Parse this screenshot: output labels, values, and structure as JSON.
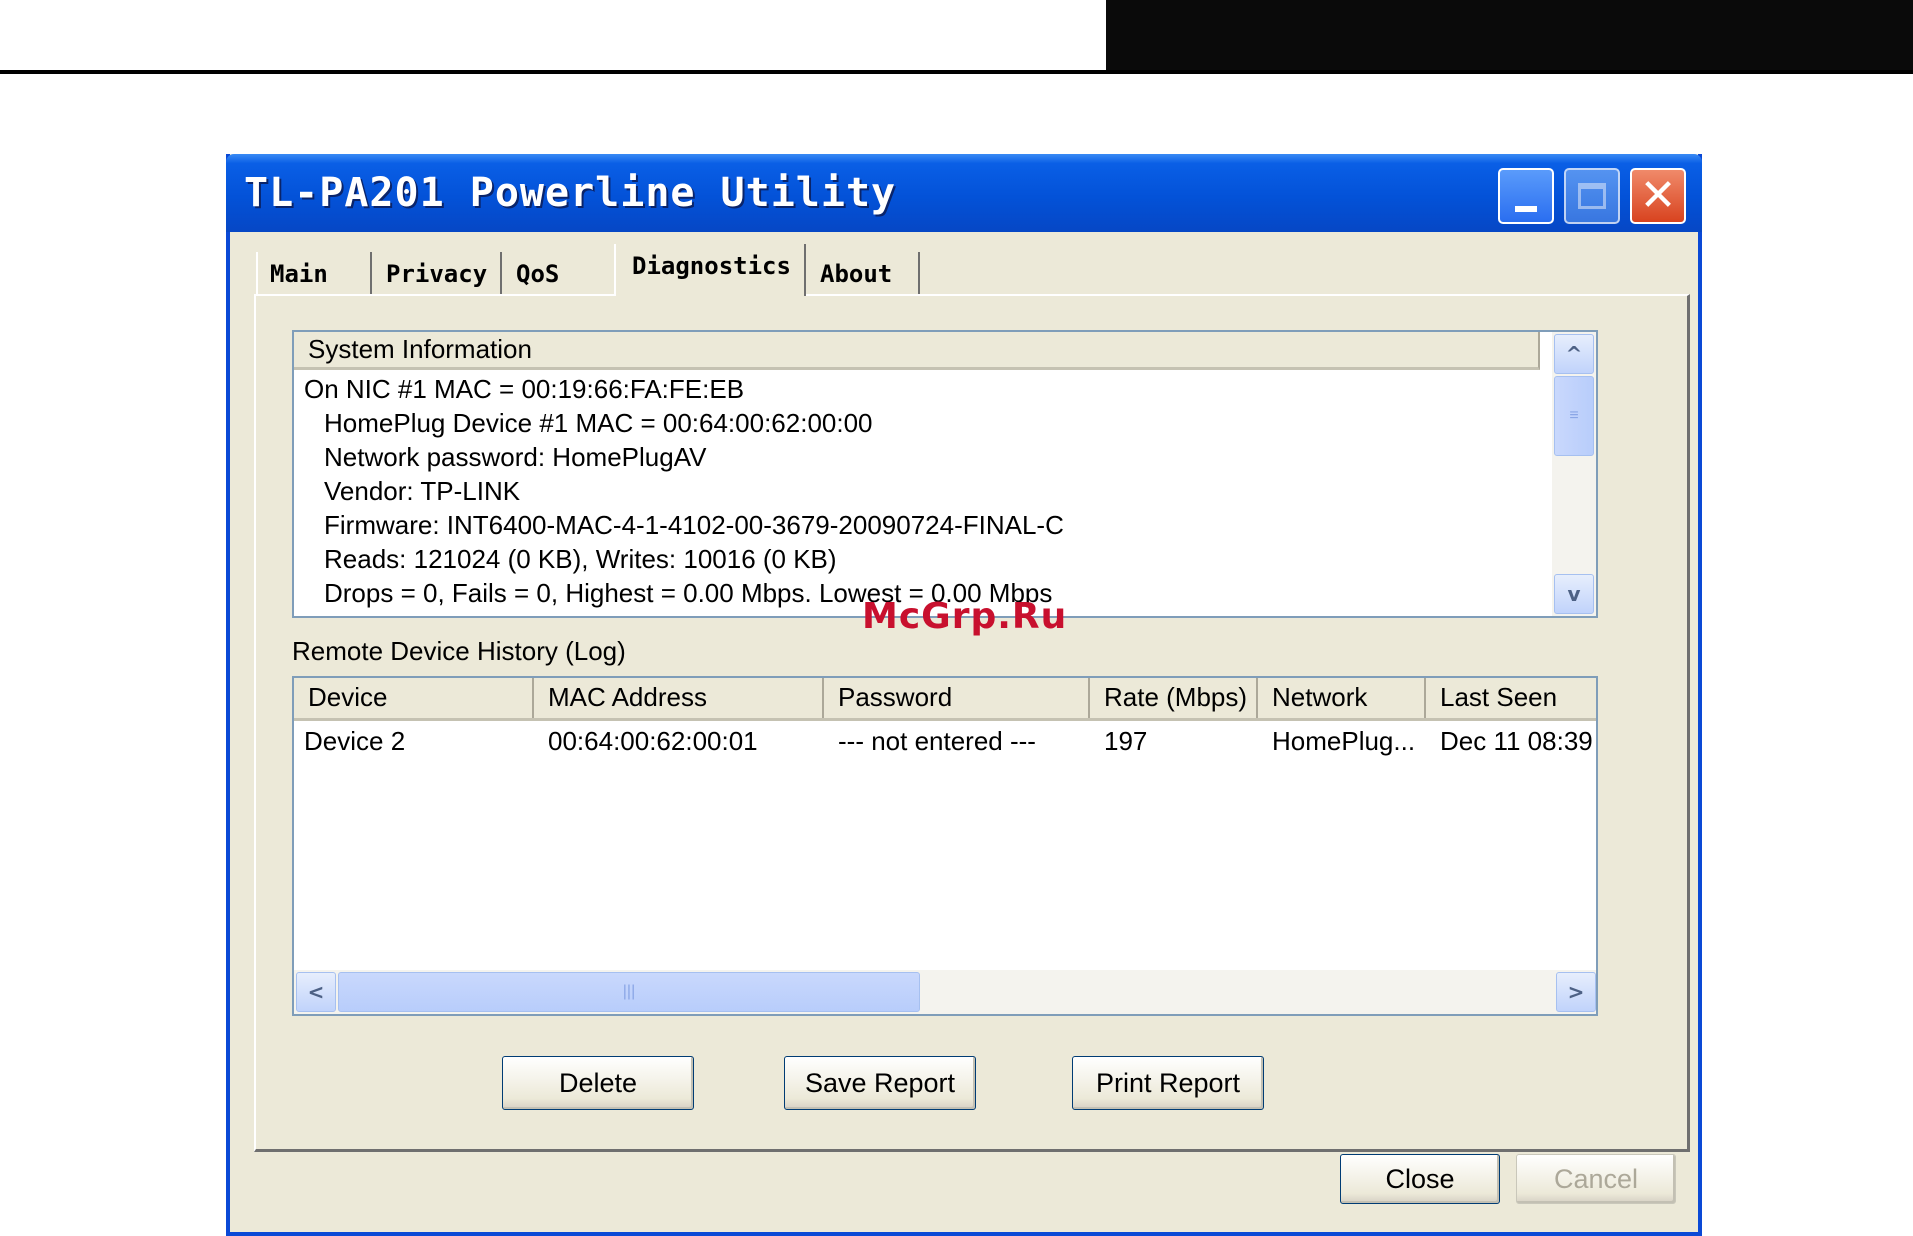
{
  "watermark": "McGrp.Ru",
  "window": {
    "title": "TL-PA201 Powerline Utility",
    "close_glyph": "✕"
  },
  "tabs": [
    {
      "label": "Main"
    },
    {
      "label": "Privacy"
    },
    {
      "label": "QoS"
    },
    {
      "label": "Diagnostics",
      "active": true
    },
    {
      "label": "About"
    }
  ],
  "system_info": {
    "header": "System Information",
    "lines": [
      "On NIC #1 MAC = 00:19:66:FA:FE:EB",
      "HomePlug Device #1 MAC = 00:64:00:62:00:00",
      "Network password: HomePlugAV",
      "Vendor: TP-LINK",
      "Firmware: INT6400-MAC-4-1-4102-00-3679-20090724-FINAL-C",
      "Reads: 121024 (0 KB), Writes: 10016 (0 KB)",
      "Drops = 0, Fails = 0, Highest = 0.00 Mbps. Lowest = 0.00 Mbps"
    ]
  },
  "log": {
    "label": "Remote Device History (Log)",
    "columns": [
      "Device",
      "MAC Address",
      "Password",
      "Rate (Mbps)",
      "Network",
      "Last Seen"
    ],
    "rows": [
      [
        "Device 2",
        "00:64:00:62:00:01",
        "--- not entered ---",
        "197",
        "HomePlug...",
        "Dec 11 08:39"
      ]
    ]
  },
  "buttons": {
    "delete": "Delete",
    "save_report": "Save Report",
    "print_report": "Print Report",
    "close": "Close",
    "cancel": "Cancel"
  },
  "icons": {
    "up": "^",
    "down": "v",
    "left": "<",
    "right": ">",
    "grip": "≡",
    "hgrip": "|||"
  }
}
